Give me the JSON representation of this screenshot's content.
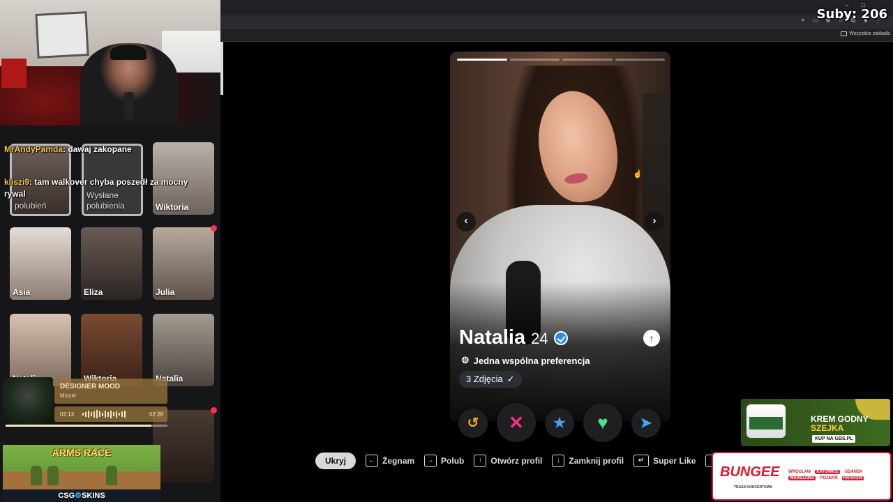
{
  "overlay": {
    "subs": "Suby: 206"
  },
  "browser": {
    "bookmarks_all": "Wszystkie zakładki"
  },
  "chat": [
    {
      "user": "MrAndyPamda",
      "message": ": dawaj zakopane"
    },
    {
      "user": "kliszi9",
      "message": ": tam walkover chyba poszedł za mocny rywal"
    }
  ],
  "sidebar": {
    "tiles_top": [
      {
        "label": "polubień"
      },
      {
        "label": "Wysłane polubienia"
      },
      {
        "label": "Wiktoria"
      }
    ],
    "matches": [
      {
        "name": "Asia"
      },
      {
        "name": "Eliza"
      },
      {
        "name": "Julia"
      },
      {
        "name": "Natalia"
      },
      {
        "name": "Wiktoria"
      },
      {
        "name": "Natalia"
      }
    ]
  },
  "music": {
    "title": "DESIGNER MOOD",
    "artist": "Miszel",
    "elapsed": "02:13",
    "total": "02:28",
    "progress": 0.9
  },
  "banner": {
    "title": "ARMS RACE",
    "brand_left": "CSG",
    "brand_right": "SKINS"
  },
  "profile": {
    "name": "Natalia",
    "age": "24",
    "preference": "Jedna wspólna preferencja",
    "photos": "3 Zdjęcia",
    "photo_count": 4,
    "active_photo": 0
  },
  "actions": [
    {
      "icon": "rewind-icon",
      "glyph": "↺",
      "color": "#f5a623"
    },
    {
      "icon": "nope-icon",
      "glyph": "✕",
      "color": "#ff2d8a"
    },
    {
      "icon": "star-icon",
      "glyph": "★",
      "color": "#38a6ff"
    },
    {
      "icon": "heart-icon",
      "glyph": "♥",
      "color": "#4fe08a"
    },
    {
      "icon": "boost-icon",
      "glyph": "➤",
      "color": "#3aa7ff"
    }
  ],
  "hints": {
    "hide": "Ukryj",
    "nope": "Żegnam",
    "like": "Polub",
    "open": "Otwórz profil",
    "close": "Zamknij profil",
    "super": "Super Like"
  },
  "ads": {
    "krem_line1": "KREM GODNY",
    "krem_line2": "SZEJKA",
    "krem_buy": "KUP NA GBS.PL",
    "bungee": "BUNGEE",
    "bungee_sub": "TRASA KONCERTOWA",
    "cities": [
      "WROCŁAW",
      "KATOWICE",
      "GDAŃSK",
      "WARSZAWA",
      "POZNAŃ",
      "KRAKÓW"
    ]
  }
}
